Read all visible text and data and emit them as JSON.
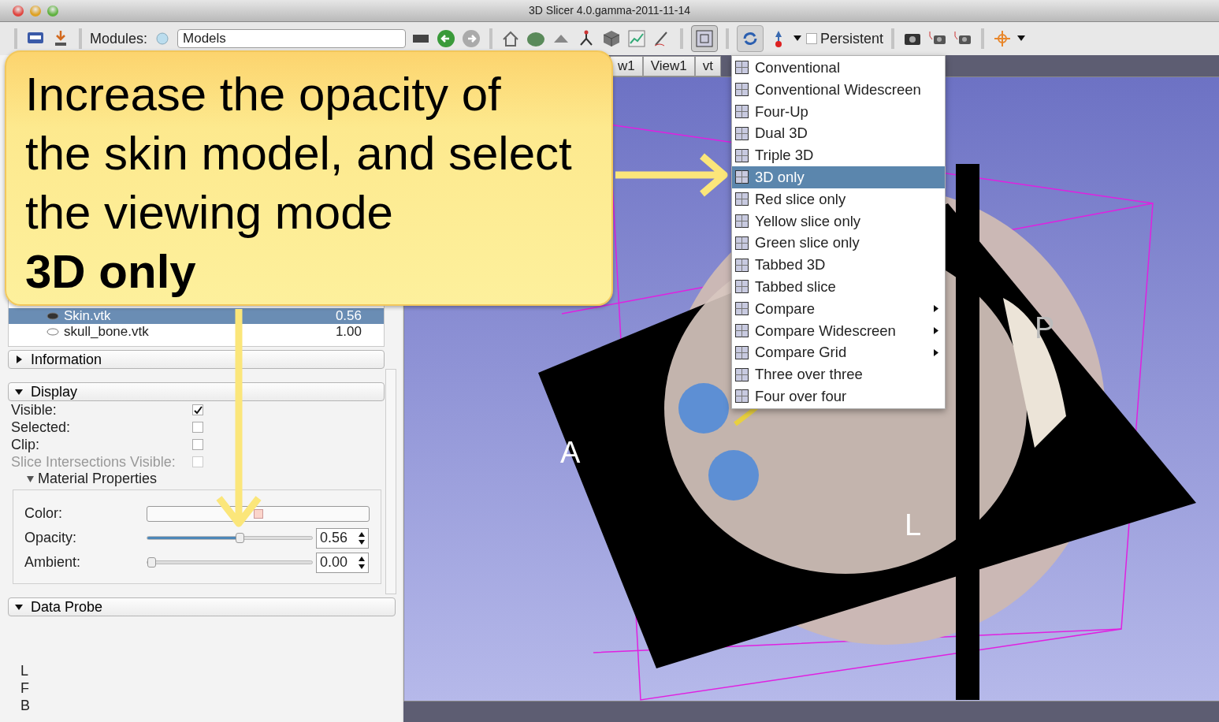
{
  "window": {
    "title": "3D Slicer 4.0.gamma-2011-11-14"
  },
  "toolbar": {
    "modules_label": "Modules:",
    "module_selector": {
      "value": "Models"
    },
    "persistent": {
      "label": "Persistent",
      "checked": false
    }
  },
  "view_tabs": [
    {
      "label": "w1"
    },
    {
      "label": "View1"
    },
    {
      "label": "vt"
    }
  ],
  "layout_menu": {
    "items": [
      {
        "label": "Conventional",
        "selected": false,
        "submenu": false
      },
      {
        "label": "Conventional Widescreen",
        "selected": false,
        "submenu": false
      },
      {
        "label": "Four-Up",
        "selected": false,
        "submenu": false
      },
      {
        "label": "Dual 3D",
        "selected": false,
        "submenu": false
      },
      {
        "label": "Triple 3D",
        "selected": false,
        "submenu": false
      },
      {
        "label": "3D only",
        "selected": true,
        "submenu": false
      },
      {
        "label": "Red slice only",
        "selected": false,
        "submenu": false
      },
      {
        "label": "Yellow slice only",
        "selected": false,
        "submenu": false
      },
      {
        "label": "Green slice only",
        "selected": false,
        "submenu": false
      },
      {
        "label": "Tabbed 3D",
        "selected": false,
        "submenu": false
      },
      {
        "label": "Tabbed slice",
        "selected": false,
        "submenu": false
      },
      {
        "label": "Compare",
        "selected": false,
        "submenu": true
      },
      {
        "label": "Compare Widescreen",
        "selected": false,
        "submenu": true
      },
      {
        "label": "Compare Grid",
        "selected": false,
        "submenu": true
      },
      {
        "label": "Three over three",
        "selected": false,
        "submenu": false
      },
      {
        "label": "Four over four",
        "selected": false,
        "submenu": false
      }
    ]
  },
  "models_tree": {
    "rows": [
      {
        "name": "Skin.vtk",
        "opacity": "0.56",
        "selected": true
      },
      {
        "name": "skull_bone.vtk",
        "opacity": "1.00",
        "selected": false
      }
    ]
  },
  "sections": [
    {
      "label": "Information",
      "expanded": false
    },
    {
      "label": "Display",
      "expanded": true
    }
  ],
  "display": {
    "checkboxes": [
      {
        "label": "Visible:",
        "checked": true,
        "disabled": false
      },
      {
        "label": "Selected:",
        "checked": false,
        "disabled": false
      },
      {
        "label": "Clip:",
        "checked": false,
        "disabled": false
      },
      {
        "label": "Slice Intersections Visible:",
        "checked": false,
        "disabled": true
      }
    ],
    "material_properties": {
      "label": "Material Properties",
      "expanded": true,
      "color": {
        "label": "Color:",
        "color": "#fbd5cb"
      },
      "sliders": [
        {
          "label": "Opacity:",
          "level": 0.56,
          "reading": "0.56"
        },
        {
          "label": "Ambient:",
          "level": 0,
          "reading": "0.00"
        }
      ]
    }
  },
  "data_probe": {
    "label": "Data Probe",
    "expanded": true,
    "lines": [
      "L",
      "F",
      "B"
    ]
  },
  "view_3d": {
    "kind": "picture",
    "orientation_labels": [
      "A",
      "L",
      "P"
    ]
  },
  "callout": {
    "text": "Increase the opacity of the skin model, and select the viewing mode **3D only**"
  }
}
